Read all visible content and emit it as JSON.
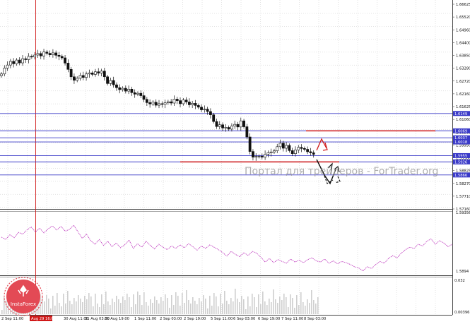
{
  "colors": {
    "background": "#ffffff",
    "grid": "#c8c8c8",
    "candle": "#111111",
    "level_line": "#3a3ac8",
    "support_resistance": "#d01818",
    "osc_line": "#c040c0",
    "volume_bar": "#cfcfcf",
    "badge_bg": "#3a3ac8",
    "logo": "#e34a55",
    "separator": "#444444"
  },
  "watermark": "Портал для трейдеров - ForTrader.org",
  "logo_label": "InstaForex",
  "price_scale": {
    "labels": [
      "1.66625",
      "1.65520",
      "1.64960",
      "1.64400",
      "1.63850",
      "1.63280",
      "1.62720",
      "1.62160",
      "1.61625",
      "1.61060",
      "1.60500",
      "1.59950",
      "1.59380",
      "1.58825",
      "1.58270",
      "1.57710",
      "1.57160"
    ],
    "badges": [
      "1.6149",
      "1.6069",
      "1.6037",
      "1.6018",
      "1.5955",
      "1.5926",
      "1.5866"
    ]
  },
  "oscillator_scale": [
    "1.59356",
    "1.5894"
  ],
  "volume_scale": [
    "0.032",
    "0.00396"
  ],
  "time_scale": [
    "2 Sep 11:00",
    "Aug 29 16:00",
    "30 Aug 11:00",
    "31 Aug 03:00",
    "31 Aug 19:00",
    "1 Sep 11:00",
    "2 Sep 03:00",
    "2 Sep 19:00",
    "5 Sep 11:00",
    "6 Sep 03:00",
    "6 Sep 19:00",
    "7 Sep 11:00",
    "8 Sep 03:00"
  ],
  "chart_data": {
    "type": "candlestick",
    "price_range": [
      1.5716,
      1.6665
    ],
    "candles_close": [
      1.6331,
      1.6358,
      1.6372,
      1.6389,
      1.6378,
      1.6395,
      1.6382,
      1.6401,
      1.6397,
      1.6412,
      1.6409,
      1.6418,
      1.6425,
      1.6414,
      1.6432,
      1.6426,
      1.6419,
      1.6428,
      1.6417,
      1.6412,
      1.6405,
      1.6381,
      1.6352,
      1.6318,
      1.6302,
      1.6311,
      1.6324,
      1.6315,
      1.6331,
      1.6336,
      1.6329,
      1.6341,
      1.6335,
      1.6344,
      1.6318,
      1.6287,
      1.6301,
      1.6281,
      1.6268,
      1.6259,
      1.6265,
      1.6252,
      1.6261,
      1.6245,
      1.6238,
      1.6242,
      1.6231,
      1.6214,
      1.6199,
      1.6193,
      1.6201,
      1.6187,
      1.6194,
      1.6191,
      1.6198,
      1.6203,
      1.6197,
      1.6215,
      1.6208,
      1.6194,
      1.6211,
      1.6202,
      1.6189,
      1.6196,
      1.6186,
      1.6178,
      1.6166,
      1.6169,
      1.6158,
      1.6143,
      1.6112,
      1.6089,
      1.6097,
      1.6082,
      1.6085,
      1.6077,
      1.6091,
      1.6099,
      1.6087,
      1.6115,
      1.6088,
      1.6041,
      1.5974,
      1.5948,
      1.5951,
      1.5952,
      1.5948,
      1.5962,
      1.5968,
      1.5972,
      1.5977,
      1.5996,
      1.6012,
      1.5989,
      1.6002,
      1.5978,
      1.5964,
      1.5981,
      1.5993,
      1.5988,
      1.5984,
      1.5973,
      1.5968,
      1.5961
    ],
    "levels_blue": [
      1.6149,
      1.6069,
      1.6037,
      1.6018,
      1.5955,
      1.5926,
      1.5866
    ],
    "level_red_upper": 1.6069,
    "level_red_lower": 1.5926,
    "oscillator_series": [
      0.62,
      0.58,
      0.66,
      0.61,
      0.7,
      0.67,
      0.74,
      0.79,
      0.71,
      0.77,
      0.69,
      0.76,
      0.81,
      0.74,
      0.8,
      0.72,
      0.75,
      0.82,
      0.71,
      0.6,
      0.67,
      0.56,
      0.5,
      0.58,
      0.48,
      0.55,
      0.46,
      0.52,
      0.44,
      0.49,
      0.57,
      0.43,
      0.51,
      0.45,
      0.55,
      0.48,
      0.42,
      0.5,
      0.45,
      0.41,
      0.47,
      0.43,
      0.49,
      0.44,
      0.51,
      0.46,
      0.4,
      0.47,
      0.43,
      0.49,
      0.45,
      0.41,
      0.36,
      0.3,
      0.38,
      0.33,
      0.29,
      0.36,
      0.31,
      0.38,
      0.35,
      0.28,
      0.2,
      0.26,
      0.19,
      0.24,
      0.21,
      0.18,
      0.25,
      0.2,
      0.23,
      0.19,
      0.24,
      0.27,
      0.22,
      0.2,
      0.25,
      0.18,
      0.22,
      0.17,
      0.21,
      0.19,
      0.16,
      0.12,
      0.1,
      0.05,
      0.12,
      0.09,
      0.16,
      0.21,
      0.18,
      0.26,
      0.31,
      0.27,
      0.35,
      0.41,
      0.45,
      0.43,
      0.5,
      0.47,
      0.55,
      0.59,
      0.5,
      0.56,
      0.52,
      0.46,
      0.5
    ]
  }
}
